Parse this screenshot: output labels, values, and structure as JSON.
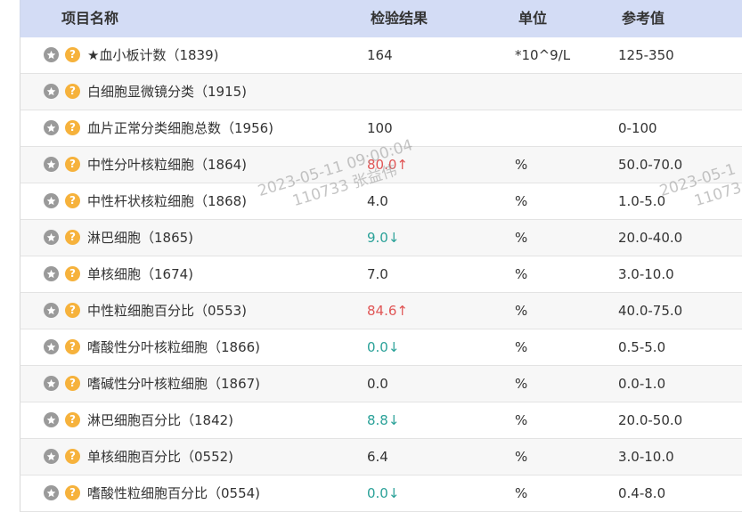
{
  "header": {
    "name": "项目名称",
    "result": "检验结果",
    "unit": "单位",
    "reference": "参考值"
  },
  "rows": [
    {
      "name": "★血小板计数（1839)",
      "result": "164",
      "flag": "",
      "unit": "*10^9/L",
      "reference": "125-350"
    },
    {
      "name": "白细胞显微镜分类（1915)",
      "result": "",
      "flag": "",
      "unit": "",
      "reference": ""
    },
    {
      "name": "血片正常分类细胞总数（1956)",
      "result": "100",
      "flag": "",
      "unit": "",
      "reference": "0-100"
    },
    {
      "name": "中性分叶核粒细胞（1864)",
      "result": "80.0↑",
      "flag": "high",
      "unit": "%",
      "reference": "50.0-70.0"
    },
    {
      "name": "中性杆状核粒细胞（1868)",
      "result": "4.0",
      "flag": "",
      "unit": "%",
      "reference": "1.0-5.0"
    },
    {
      "name": "淋巴细胞（1865)",
      "result": "9.0↓",
      "flag": "low",
      "unit": "%",
      "reference": "20.0-40.0"
    },
    {
      "name": "单核细胞（1674)",
      "result": "7.0",
      "flag": "",
      "unit": "%",
      "reference": "3.0-10.0"
    },
    {
      "name": "中性粒细胞百分比（0553)",
      "result": "84.6↑",
      "flag": "high",
      "unit": "%",
      "reference": "40.0-75.0"
    },
    {
      "name": "嗜酸性分叶核粒细胞（1866)",
      "result": "0.0↓",
      "flag": "low",
      "unit": "%",
      "reference": "0.5-5.0"
    },
    {
      "name": "嗜碱性分叶核粒细胞（1867)",
      "result": "0.0",
      "flag": "",
      "unit": "%",
      "reference": "0.0-1.0"
    },
    {
      "name": "淋巴细胞百分比（1842)",
      "result": "8.8↓",
      "flag": "low",
      "unit": "%",
      "reference": "20.0-50.0"
    },
    {
      "name": "单核细胞百分比（0552)",
      "result": "6.4",
      "flag": "",
      "unit": "%",
      "reference": "3.0-10.0"
    },
    {
      "name": "嗜酸性粒细胞百分比（0554)",
      "result": "0.0↓",
      "flag": "low",
      "unit": "%",
      "reference": "0.4-8.0"
    }
  ],
  "watermark": {
    "line1": "2023-05-11 09:00:04",
    "line2": "110733 张益伟",
    "line1_right": "2023-05-1",
    "line2_right": "11073"
  },
  "colors": {
    "header_bg": "#d3dcf5",
    "high": "#e05555",
    "low": "#2aa198",
    "help_icon": "#f6b23c",
    "star_icon": "#9a9a9a"
  }
}
